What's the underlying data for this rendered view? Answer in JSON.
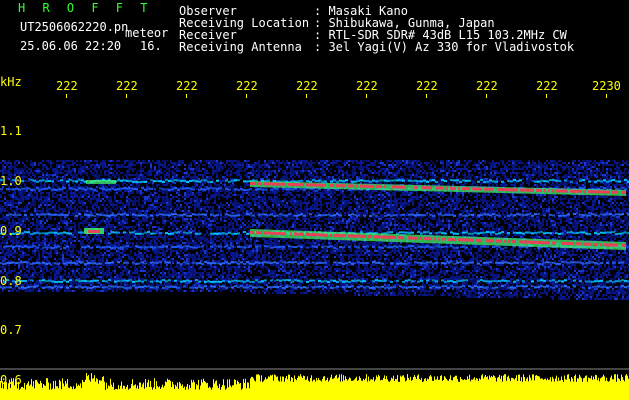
{
  "header": {
    "brand": "H R O F F T",
    "filename": "UT2506062220.pn",
    "tag": "meteor",
    "datetime": "25.06.06 22:20",
    "counter": "16.",
    "fields": [
      {
        "label": "Observer",
        "value": ": Masaki Kano"
      },
      {
        "label": "Receiving Location",
        "value": ": Shibukawa, Gunma, Japan"
      },
      {
        "label": "Receiver",
        "value": ": RTL-SDR SDR# 43dB L15 103.2MHz CW"
      },
      {
        "label": "Receiving Antenna",
        "value": ": 3el Yagi(V) Az 330 for Vladivostok"
      }
    ]
  },
  "axis": {
    "unit": "kHz",
    "y_ticks": [
      "1.1",
      "1.0",
      "0.9",
      "0.8",
      "0.7",
      "0.6"
    ],
    "x_ticks": [
      "222",
      "222",
      "222",
      "222",
      "222",
      "222",
      "222",
      "222",
      "222",
      "2230"
    ]
  },
  "colors": {
    "background": "#000000",
    "text": "#ffffff",
    "accent_yellow": "#ffff00",
    "brand_green": "#33ff33",
    "noise_blue": "#0a1aa0",
    "signal_cyan": "#00c8ff",
    "signal_green": "#44ff66",
    "signal_red": "#ff3355"
  }
}
